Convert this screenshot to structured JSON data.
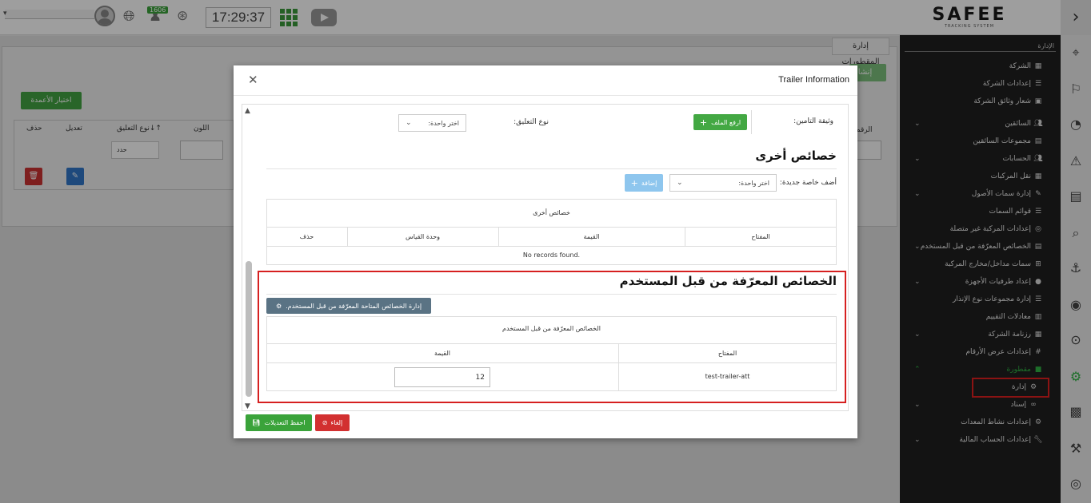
{
  "topbar": {
    "notif_count": "1606",
    "clock": "17:29:37",
    "logo_main": "SAFEE",
    "logo_sub": "TRACKING SYSTEM"
  },
  "background": {
    "tab_label": "إدارة المقطورات",
    "create_btn": "إنشاء",
    "columns_btn": "اختيار الأعمدة",
    "col_delete": "حذف",
    "col_edit": "تعديل",
    "col_attach_type": "نوع التعليق↓↑",
    "col_color": "اللون",
    "col_no": "الرقم",
    "select_value": "حدد"
  },
  "sidebar": {
    "section": "الإدارة",
    "items": [
      {
        "label": "الشركة",
        "icon": "building"
      },
      {
        "label": "إعدادات الشركة",
        "icon": "list"
      },
      {
        "label": "شعار وثائق الشركة",
        "icon": "image"
      },
      {
        "label": "السائقين",
        "icon": "users"
      },
      {
        "label": "مجموعات السائقين",
        "icon": "group"
      },
      {
        "label": "الحسابات",
        "icon": "users"
      },
      {
        "label": "نقل المركبات",
        "icon": "grid"
      },
      {
        "label": "إدارة سمات الأصول",
        "icon": "edit"
      },
      {
        "label": "قوائم السمات",
        "icon": "list"
      },
      {
        "label": "إعدادات المركبة غير متصلة",
        "icon": "eye-slash"
      },
      {
        "label": "الخصائص المعرّفة من قبل المستخدم",
        "icon": "table"
      },
      {
        "label": "سمات مداخل/مخارج المركبة",
        "icon": "grid"
      },
      {
        "label": "إعداد طرفيات الأجهزة",
        "icon": "circle"
      },
      {
        "label": "إدارة مجموعات نوع الإنذار",
        "icon": "list"
      },
      {
        "label": "معادلات التقييم",
        "icon": "calculator"
      },
      {
        "label": "رزنامة الشركة",
        "icon": "calendar"
      },
      {
        "label": "إعدادات عرض الأرقام",
        "icon": "hash"
      },
      {
        "label": "مقطورة",
        "icon": "square"
      },
      {
        "label": "إدارة",
        "icon": "cogs"
      },
      {
        "label": "إسناد",
        "icon": "link"
      },
      {
        "label": "إعدادات نشاط المعدات",
        "icon": "cogs"
      },
      {
        "label": "إعدادات الحساب المالية",
        "icon": "wrench"
      }
    ]
  },
  "modal": {
    "title": "Trailer Information",
    "insurance_doc_label": "وثيقة التامين:",
    "upload_btn": "ارفع الملف",
    "attach_type_label": "نوع التعليق:",
    "select_placeholder": "اختر واحدة:",
    "other_props_title": "خصائص أخرى",
    "add_prop_label": "أضف خاصة جديدة:",
    "add_btn": "إضافة",
    "other_table": {
      "caption": "خصائص أخرى",
      "columns": [
        "المفتاح",
        "القيمة",
        "وحدة القياس",
        "حذف"
      ],
      "empty": "No records found."
    },
    "udp_title": "الخصائص المعرّفة من قبل المستخدم",
    "udp_manage_btn": "إدارة الخصائص المتاحة المعرّفة من قبل المستخدم.",
    "udp_table": {
      "caption": "الخصائص المعرّفة من قبل المستخدم",
      "columns": [
        "المفتاح",
        "القيمة"
      ],
      "rows": [
        {
          "key": "test-trailer-att",
          "value": "12"
        }
      ]
    },
    "save_btn": "احفظ التعديلات",
    "cancel_btn": "إلغاء"
  }
}
